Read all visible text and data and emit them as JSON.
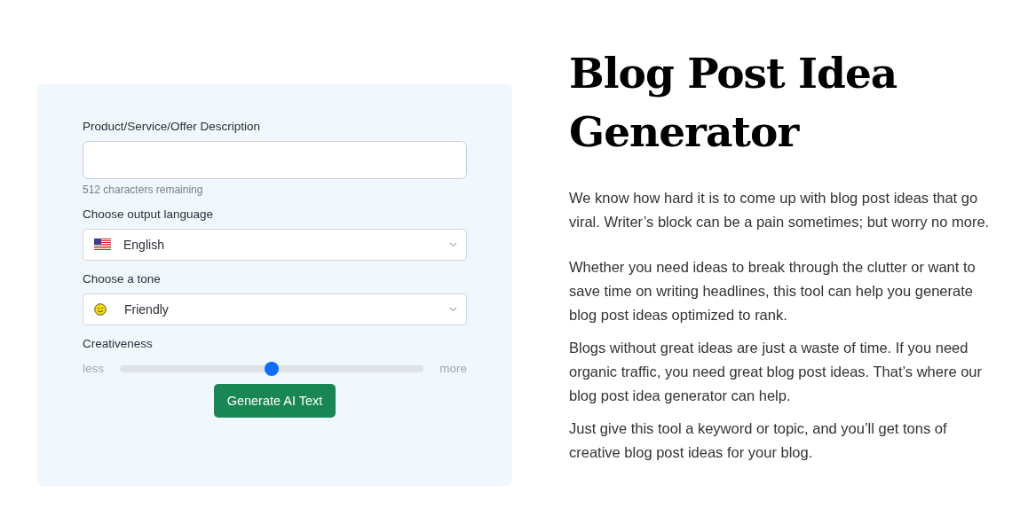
{
  "form": {
    "description": {
      "label": "Product/Service/Offer Description",
      "hint": "512 characters remaining"
    },
    "language": {
      "label": "Choose output language",
      "value": "English"
    },
    "tone": {
      "label": "Choose a tone",
      "value": "Friendly"
    },
    "creativeness": {
      "label": "Creativeness",
      "min_label": "less",
      "max_label": "more",
      "level": 0.5
    },
    "button": "Generate AI Text"
  },
  "article": {
    "title": "Blog Post Idea Generator",
    "paragraphs": [
      "We know how hard it is to come up with blog post ideas that go viral. Writer’s block can be a pain sometimes; but worry no more.",
      "Whether you need ideas to break through the clutter or want to save time on writing headlines, this tool can help you generate blog post ideas optimized to rank.",
      "Blogs without great ideas are just a waste of time. If you need organic traffic, you need great blog post ideas. That’s where our blog post idea generator can help.",
      "Just give this tool a keyword or topic, and you’ll get tons of creative blog post ideas for your blog."
    ]
  }
}
